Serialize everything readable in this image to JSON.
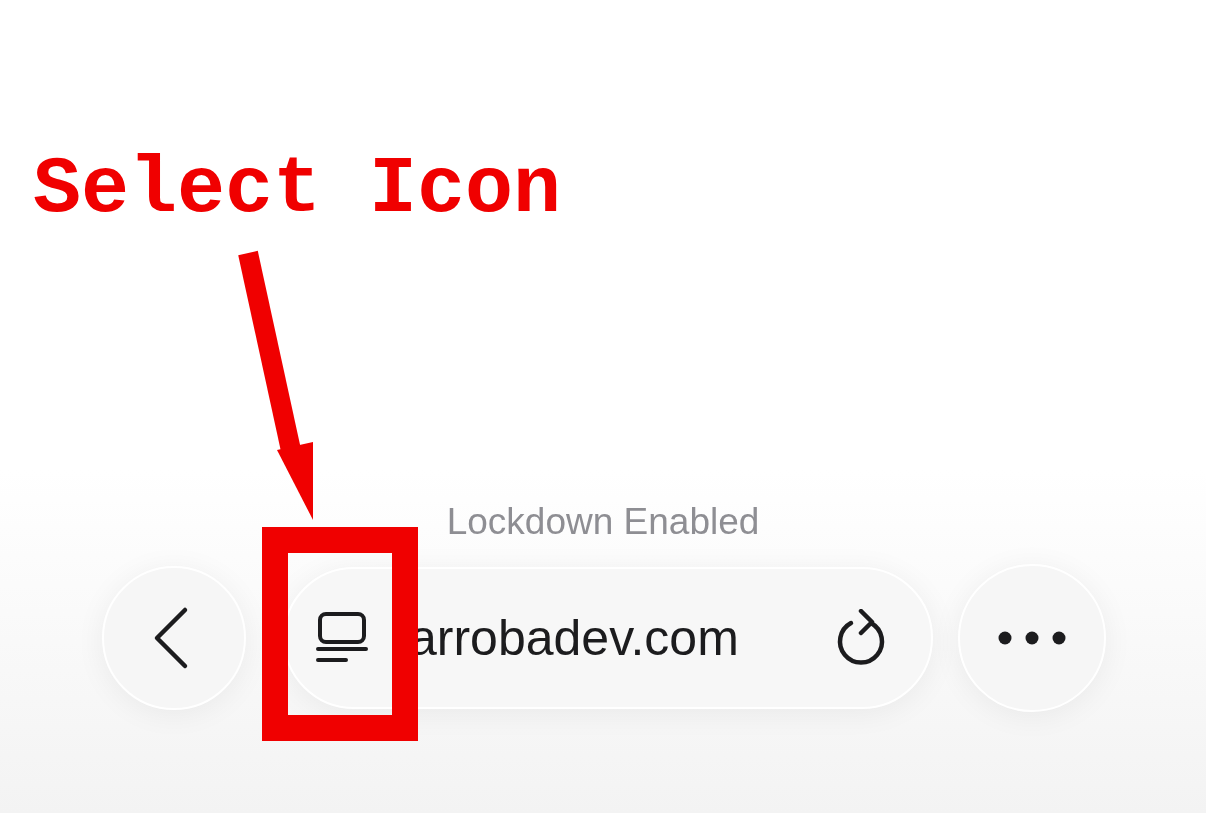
{
  "annotation": {
    "label": "Select Icon"
  },
  "status": {
    "text": "Lockdown Enabled"
  },
  "toolbar": {
    "address": "arrobadev.com"
  }
}
